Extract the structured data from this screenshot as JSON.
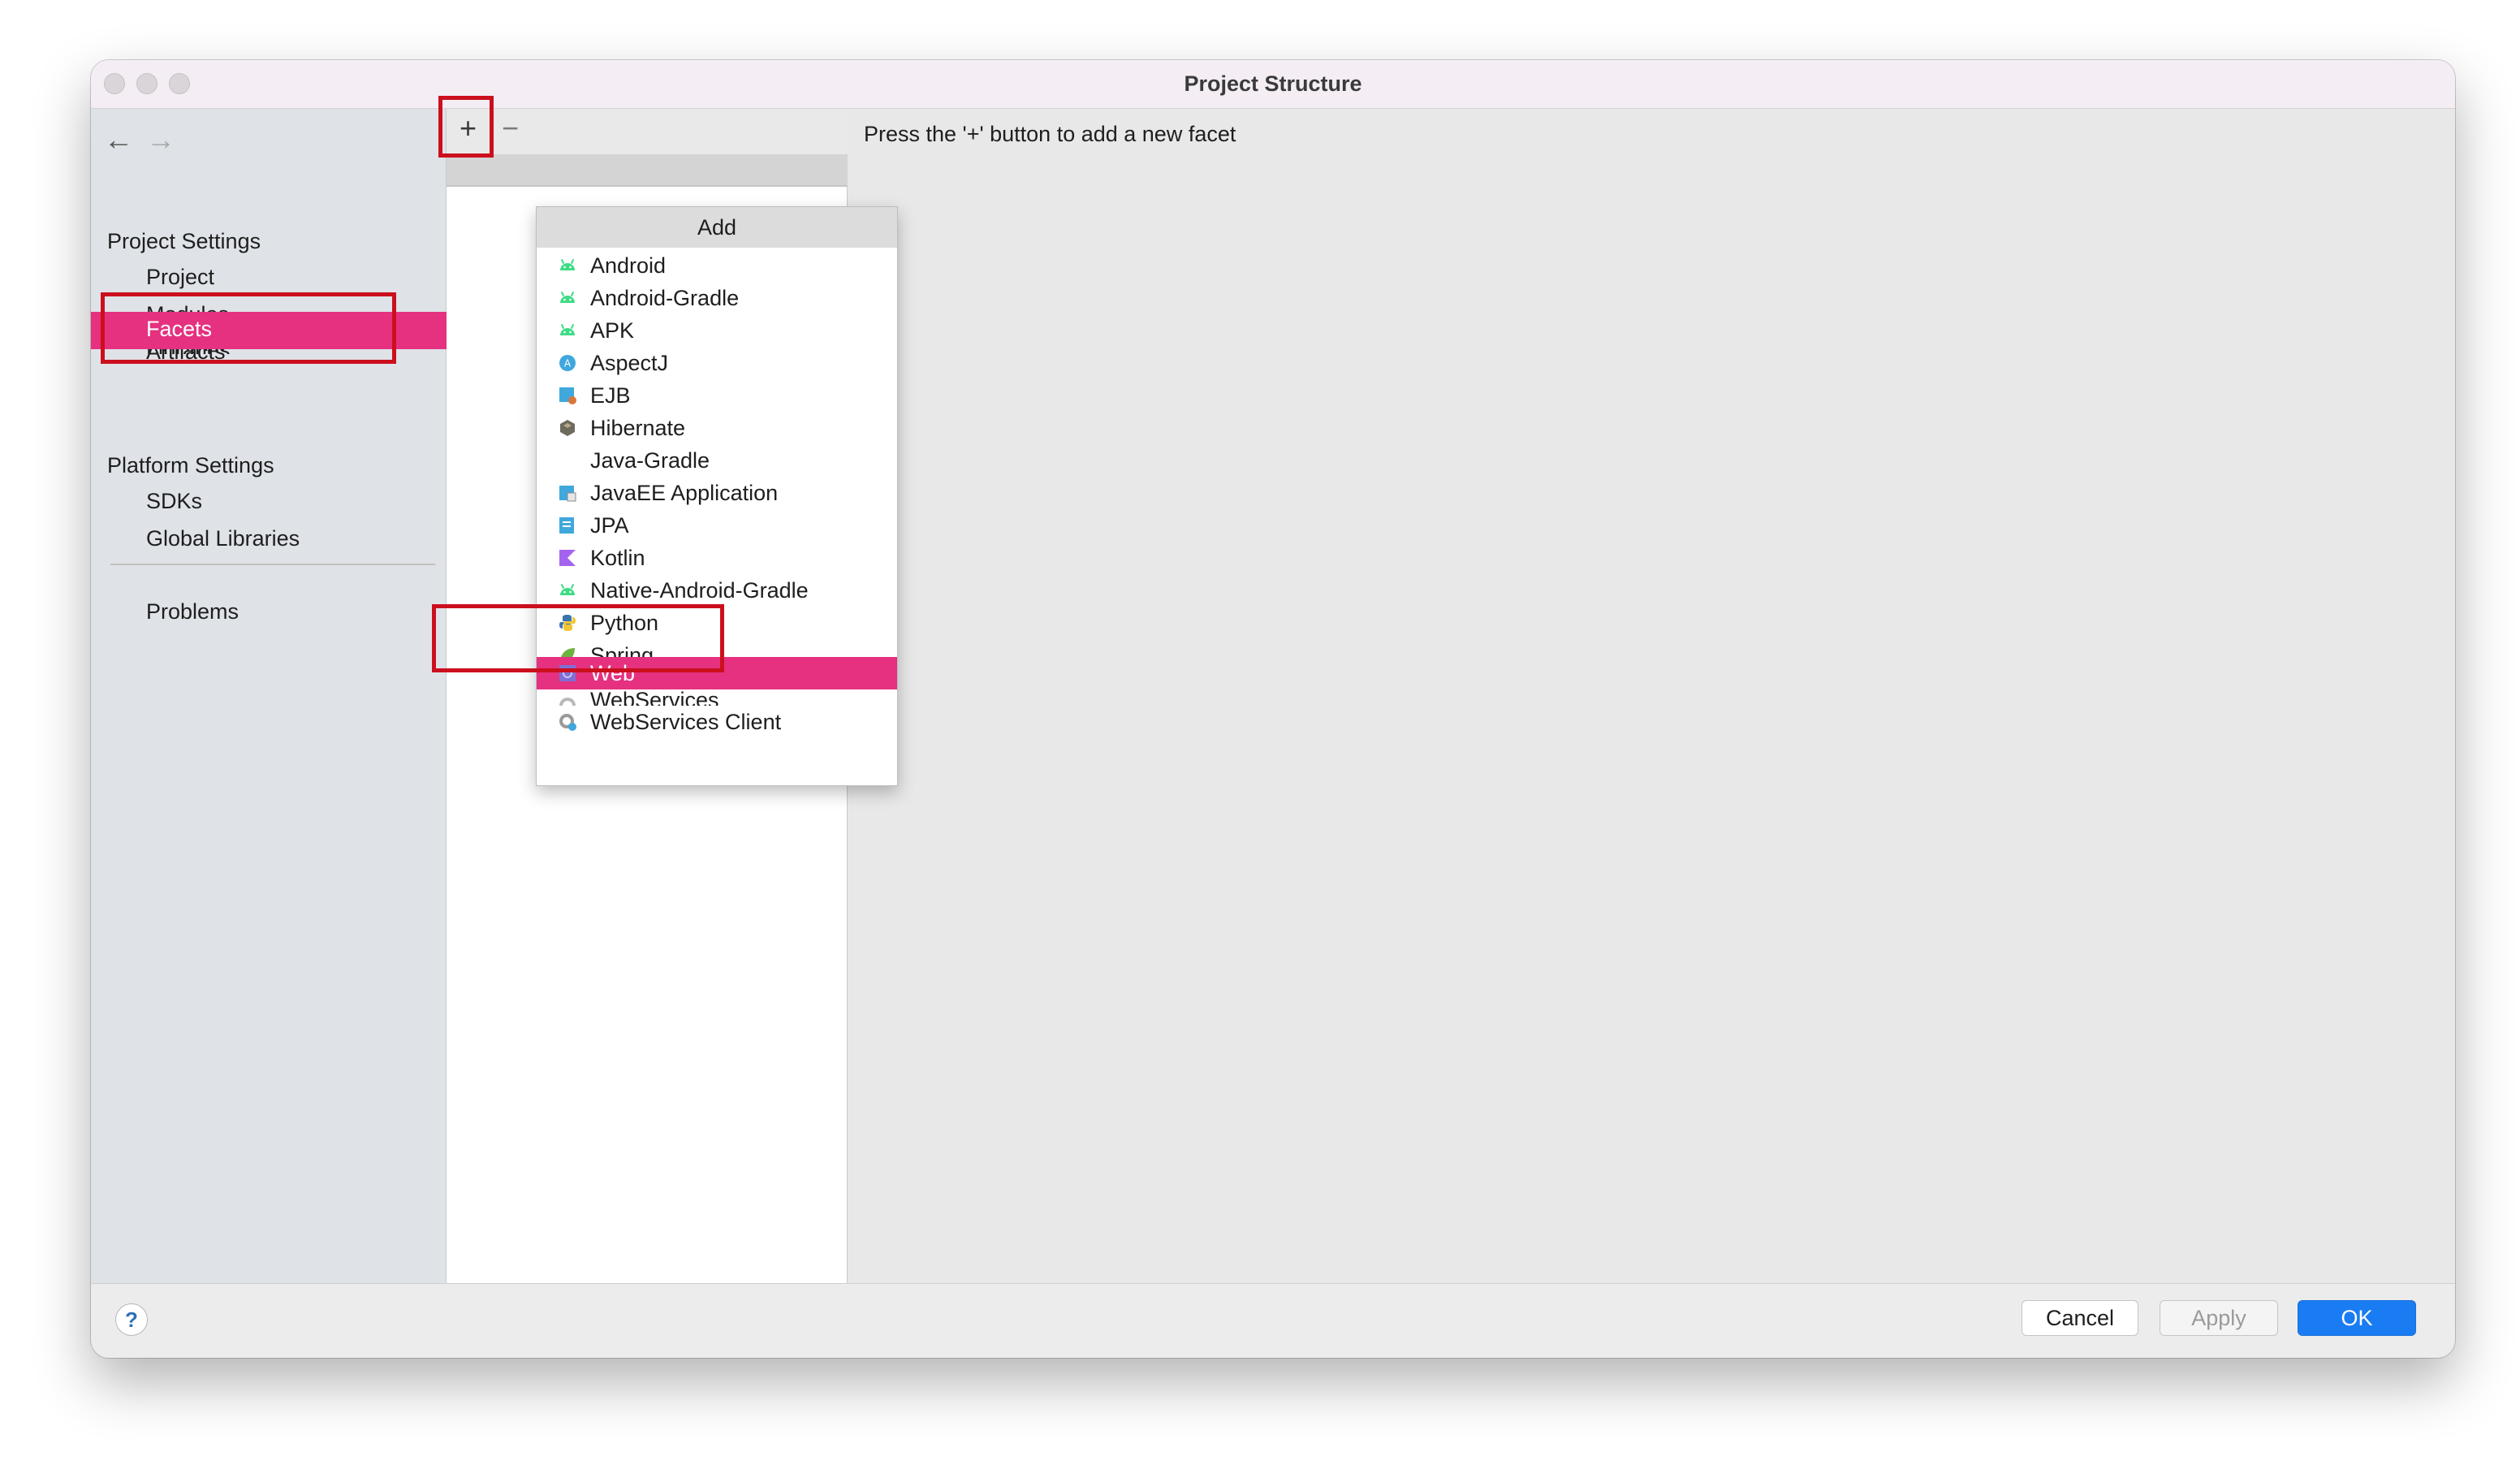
{
  "window": {
    "title": "Project Structure"
  },
  "sidebar": {
    "project_settings_header": "Project Settings",
    "items": [
      "Project",
      "Modules",
      "Libraries",
      "Facets",
      "Artifacts"
    ],
    "platform_settings_header": "Platform Settings",
    "platform_items": [
      "SDKs",
      "Global Libraries"
    ],
    "problems": "Problems",
    "selected": "Facets"
  },
  "toolbar": {
    "add": "+",
    "remove": "−",
    "back": "←",
    "forward": "→"
  },
  "add_popup": {
    "title": "Add",
    "items": [
      {
        "label": "Android",
        "icon": "android-icon"
      },
      {
        "label": "Android-Gradle",
        "icon": "android-icon"
      },
      {
        "label": "APK",
        "icon": "android-icon"
      },
      {
        "label": "AspectJ",
        "icon": "aspectj-icon"
      },
      {
        "label": "EJB",
        "icon": "ejb-icon"
      },
      {
        "label": "Hibernate",
        "icon": "hibernate-icon"
      },
      {
        "label": "Java-Gradle",
        "icon": ""
      },
      {
        "label": "JavaEE Application",
        "icon": "javaee-icon"
      },
      {
        "label": "JPA",
        "icon": "jpa-icon"
      },
      {
        "label": "Kotlin",
        "icon": "kotlin-icon"
      },
      {
        "label": "Native-Android-Gradle",
        "icon": "android-icon"
      },
      {
        "label": "Python",
        "icon": "python-icon"
      },
      {
        "label": "Spring",
        "icon": "spring-icon"
      },
      {
        "label": "Web",
        "icon": "web-icon"
      },
      {
        "label": "WebServices",
        "icon": "webservices-icon"
      },
      {
        "label": "WebServices Client",
        "icon": "webservices-client-icon"
      }
    ],
    "selected": "Web"
  },
  "content": {
    "hint": "Press the '+' button to add a new facet"
  },
  "footer": {
    "help": "?",
    "cancel": "Cancel",
    "apply": "Apply",
    "ok": "OK"
  },
  "colors": {
    "selection": "#e5317f",
    "highlight_box": "#cc0f1d",
    "primary_button": "#1a7cf2"
  }
}
